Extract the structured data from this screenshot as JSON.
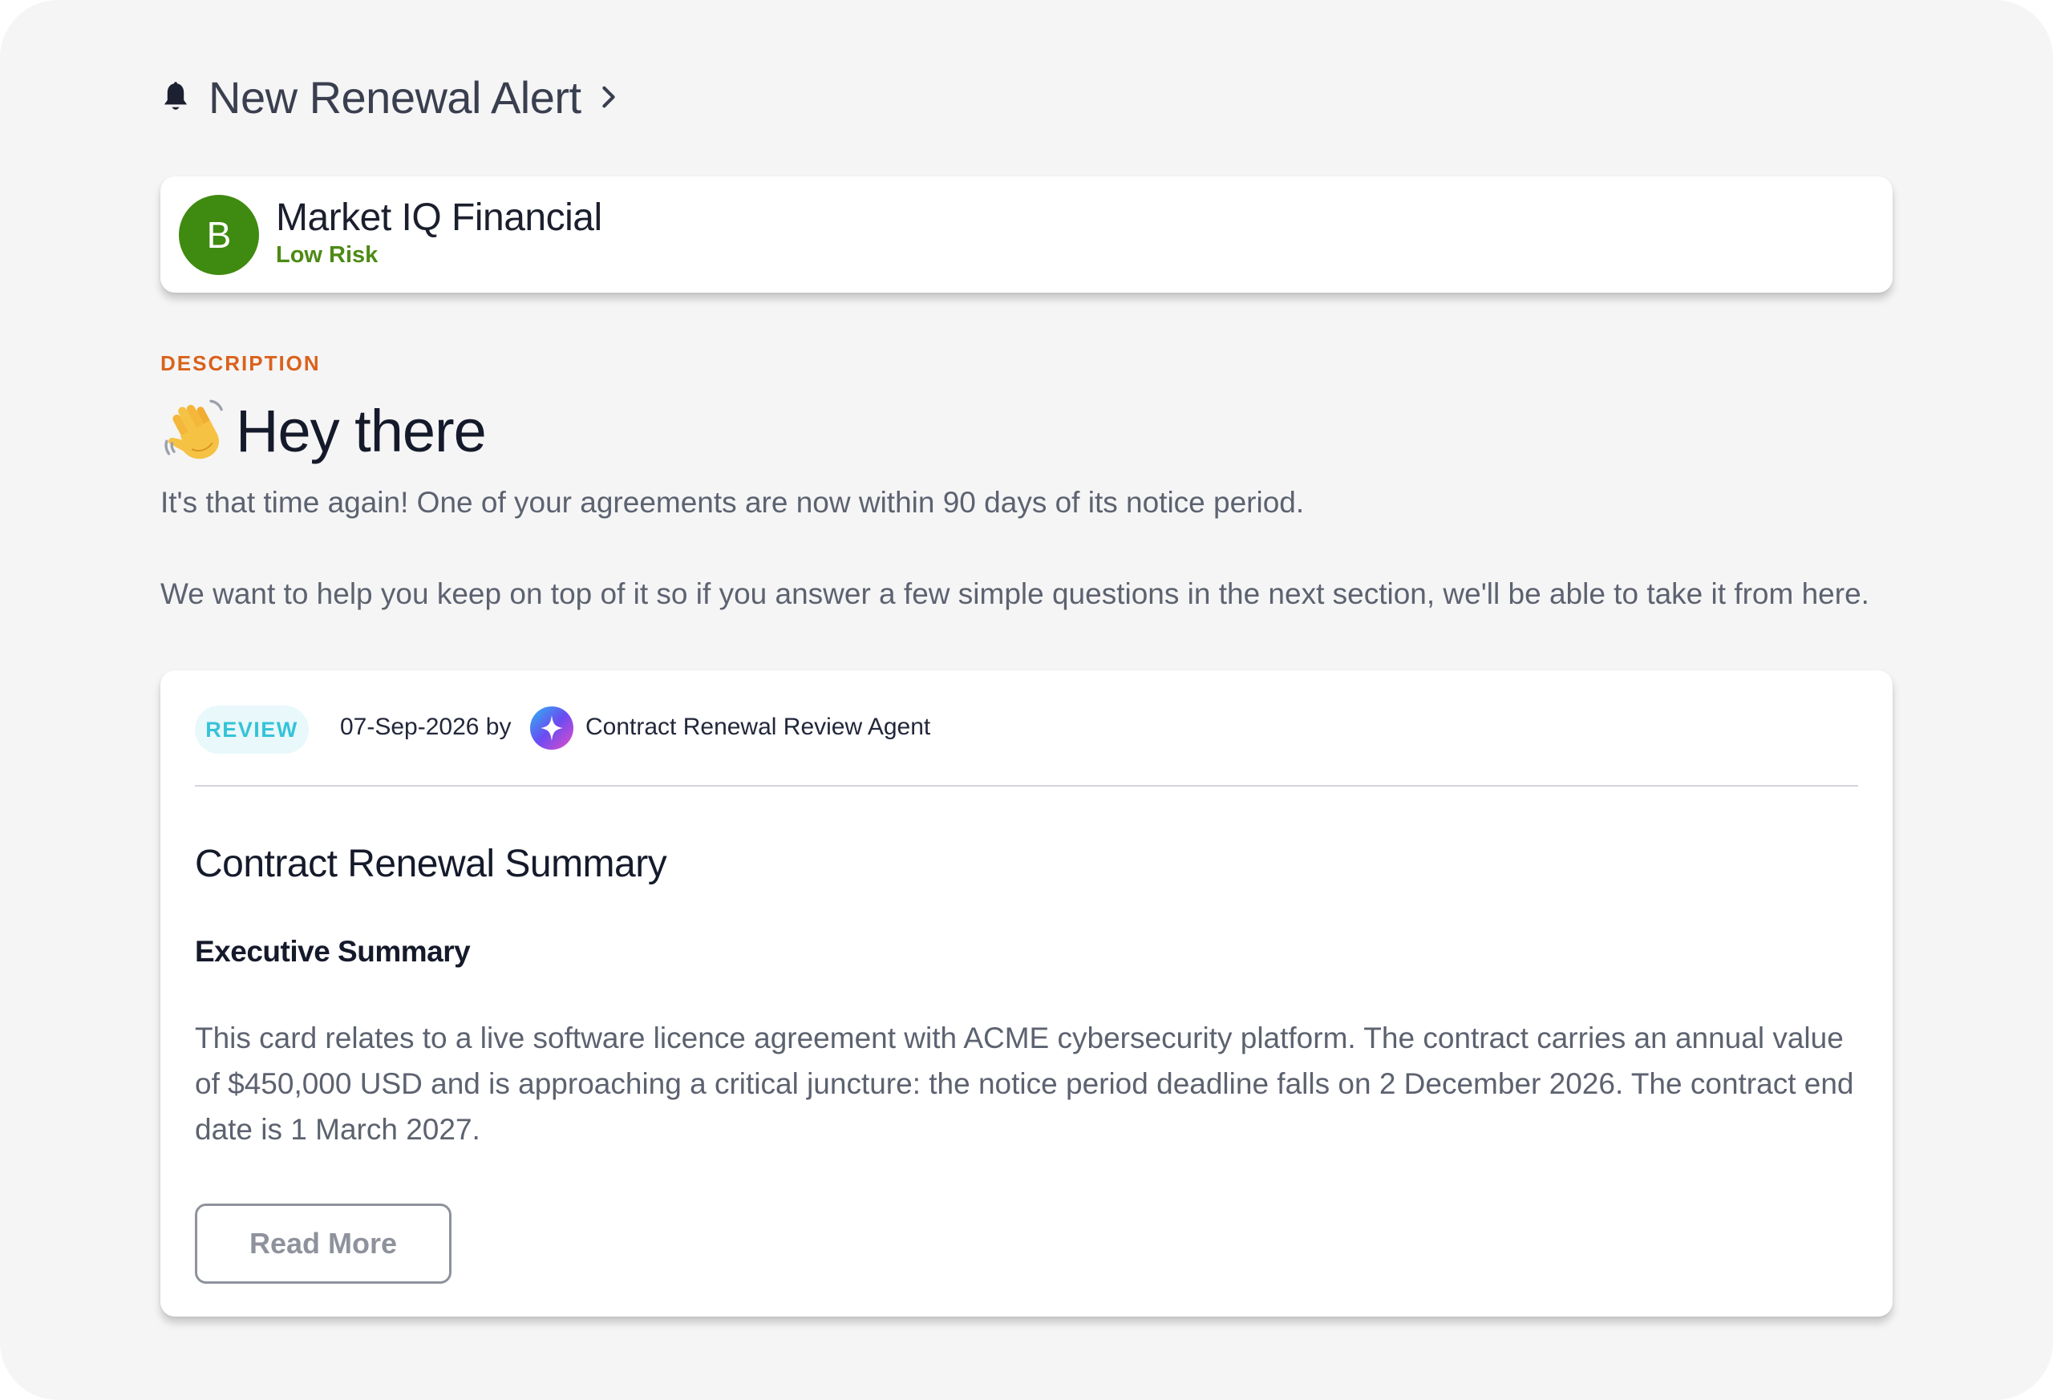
{
  "header": {
    "title": "New Renewal Alert",
    "bell_icon": "bell-icon",
    "chevron_icon": "chevron-right-icon"
  },
  "org": {
    "avatar_letter": "B",
    "name": "Market IQ Financial",
    "risk": "Low Risk",
    "avatar_color": "#3f8a10",
    "risk_color": "#4d8a16"
  },
  "description": {
    "label": "DESCRIPTION",
    "greeting": "Hey there",
    "greeting_icon": "waving-hand-icon",
    "paragraph1": "It's that time again! One of your agreements are now within 90 days of its notice period.",
    "paragraph2": "We want to help you keep on top of it so if you answer a few simple questions in the next section, we'll be able to take it from here."
  },
  "review": {
    "badge": "REVIEW",
    "date_by": "07-Sep-2026 by",
    "agent_icon": "sparkle-agent-icon",
    "agent_name": "Contract Renewal Review Agent",
    "title": "Contract Renewal Summary",
    "section_title": "Executive Summary",
    "body": "This card relates to a live software licence agreement with ACME cybersecurity platform. The contract carries an annual value of $450,000 USD and is approaching a critical juncture: the notice period deadline falls on 2 December 2026. The contract end date is 1 March 2027.",
    "read_more_label": "Read More",
    "badge_color": "#35c3d8"
  },
  "colors": {
    "accent_orange": "#d9621b",
    "background": "#f5f5f6"
  }
}
